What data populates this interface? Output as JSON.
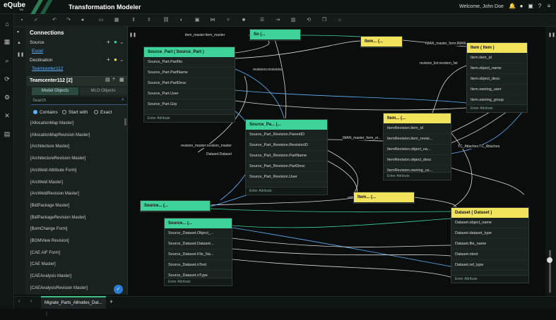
{
  "app": {
    "logo_text": "eQube",
    "logo_sub": "TM",
    "title": "Transformation Modeler",
    "welcome": "Welcome, John Doe"
  },
  "panel": {
    "connections_title": "Connections",
    "source_label": "Source",
    "source_value": "Excel",
    "destination_label": "Destination",
    "destination_value": "Teamcenter112",
    "tc_title": "Teamcenter112 [2]",
    "tab_model_objects": "Model Objects",
    "tab_mlo_objects": "MLO Objects",
    "search_placeholder": "Search",
    "radio_contains": "Contains",
    "radio_start_with": "Start with",
    "radio_exact": "Exact",
    "items": [
      "[AllocationMap Master]",
      "[AllocationMapRevision Master]",
      "[Architecture Master]",
      "[ArchitectureRevision Master]",
      "[ArcWeld Attribute Form]",
      "[ArcWeld Master]",
      "[ArcWeldRevision Master]",
      "[BidPackage Master]",
      "[BidPackageRevision Master]",
      "[BomChange Form]",
      "[BOMView Revision]",
      "[CAE AIF Form]",
      "[CAE Master]",
      "[CAEAnalysis Master]",
      "[CAEAnalysisRevision Master]"
    ]
  },
  "bottom": {
    "tab_label": "Migrate_Parts_Allnodes_Dat..."
  },
  "nodes": {
    "source_part": {
      "title": "Source_Part       ( Source_Part )",
      "rows": [
        "Source_Part.PartNo",
        "Source_Part.PartName",
        "Source_Part.PartDesc",
        "Source_Part.User",
        "Source_Part.Grp"
      ],
      "footer": "Enter Attribute"
    },
    "source_small1": {
      "title": "So          (..."
    },
    "item_small1": {
      "title": "Item...        (..."
    },
    "item": {
      "title": "Item          ( Item )",
      "rows": [
        "Item.item_id",
        "Item.object_name",
        "Item.object_desc",
        "Item.owning_user",
        "Item.owning_group"
      ],
      "footer": "Enter Attribute"
    },
    "source_part_rev": {
      "title": "Source_Pa...       (...",
      "rows": [
        "Source_Part_Revision.ParentID",
        "Source_Part_Revision.RevisionID",
        "Source_Part_Revision.PartName",
        "Source_Part_Revision.PartDesc",
        "Source_Part_Revision.User"
      ],
      "footer": "Enter Attribute"
    },
    "item_rev": {
      "title": "Item...        (...",
      "rows": [
        "ItemRevision.item_id",
        "ItemRevision.item_revisi...",
        "ItemRevision.object_na...",
        "ItemRevision.object_desc",
        "ItemRevision.owning_us..."
      ],
      "footer": "Enter Attribute"
    },
    "source_small2": {
      "title": "Source...       (..."
    },
    "item_small2": {
      "title": "Item...        (..."
    },
    "source_dataset": {
      "title": "Source...      (...",
      "rows": [
        "Source_Dataset.Object_...",
        "Source_Dataset.Dataset...",
        "Source_Dataset.File_Na...",
        "Source_Dataset.nText",
        "Source_Dataset.nType"
      ],
      "footer": "Enter Attribute"
    },
    "dataset": {
      "title": "Dataset          ( Dataset )",
      "rows": [
        "Dataset.object_name",
        "Dataset.dataset_type",
        "Dataset.file_name",
        "Dataset.ntext",
        "Dataset.ref_type"
      ],
      "footer": "Enter Attribute"
    }
  },
  "connector_labels": {
    "c1": "item_master:item_master",
    "c2": "IMAN_master_form:IMAN...",
    "c3": "revisions:revisions",
    "c4": "revision_list:revision_list",
    "c5": "revision_master:revision_master",
    "c6": "Dataset:Dataset",
    "c7": "IMAN_master_form_re...",
    "c8": "TC_Attaches:TC_Attaches"
  }
}
